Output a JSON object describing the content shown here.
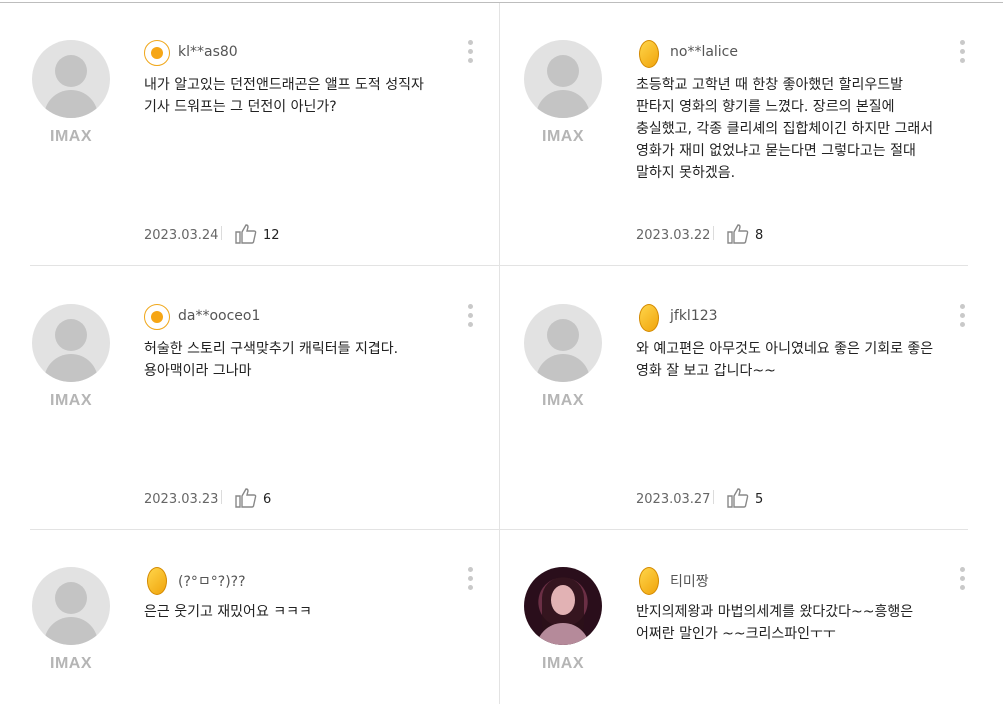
{
  "reviews": [
    {
      "username": "kl**as80",
      "grade": "egg",
      "badge": "IMAX",
      "avatar": "default-avatar",
      "comment": "내가 알고있는 던전앤드래곤은 앨프 도적 성직자 기사 드워프는 그 던전이 아닌가?",
      "date": "2023.03.24",
      "likes": "12"
    },
    {
      "username": "no**lalice",
      "grade": "golden-egg",
      "badge": "IMAX",
      "avatar": "default-avatar",
      "comment": "초등학교 고학년 때 한창 좋아했던 할리우드발 판타지 영화의 향기를 느꼈다. 장르의 본질에 충실했고, 각종 클리셰의 집합체이긴 하지만 그래서 영화가 재미 없었냐고 묻는다면 그렇다고는 절대 말하지 못하겠음.",
      "date": "2023.03.22",
      "likes": "8"
    },
    {
      "username": "da**ooceo1",
      "grade": "egg",
      "badge": "IMAX",
      "avatar": "default-avatar",
      "comment": "허술한 스토리 구색맞추기 캐릭터들 지겹다. 용아맥이라 그나마",
      "date": "2023.03.23",
      "likes": "6"
    },
    {
      "username": "jfkl123",
      "grade": "golden-egg",
      "badge": "IMAX",
      "avatar": "default-avatar",
      "comment": "와 예고편은 아무것도 아니였네요 좋은 기회로 좋은 영화 잘 보고 갑니다~~",
      "date": "2023.03.27",
      "likes": "5"
    },
    {
      "username": "(?°ㅁ°?)??",
      "grade": "golden-egg",
      "badge": "IMAX",
      "avatar": "default-avatar",
      "comment": "은근 웃기고 재밌어요 ㅋㅋㅋ",
      "date": "",
      "likes": ""
    },
    {
      "username": "티미짱",
      "grade": "golden-egg",
      "badge": "IMAX",
      "avatar": "profile-photo",
      "comment": "반지의제왕과 마법의세계를 왔다갔다~~흥행은 어쩌란 말인가 ~~크리스파인ㅜㅜ",
      "date": "",
      "likes": ""
    }
  ],
  "colors": {
    "egg_yolk": "#f6a615",
    "gold": "#f0a40c",
    "badge_gray": "#b5b5b5",
    "divider": "#e3e3e3"
  }
}
